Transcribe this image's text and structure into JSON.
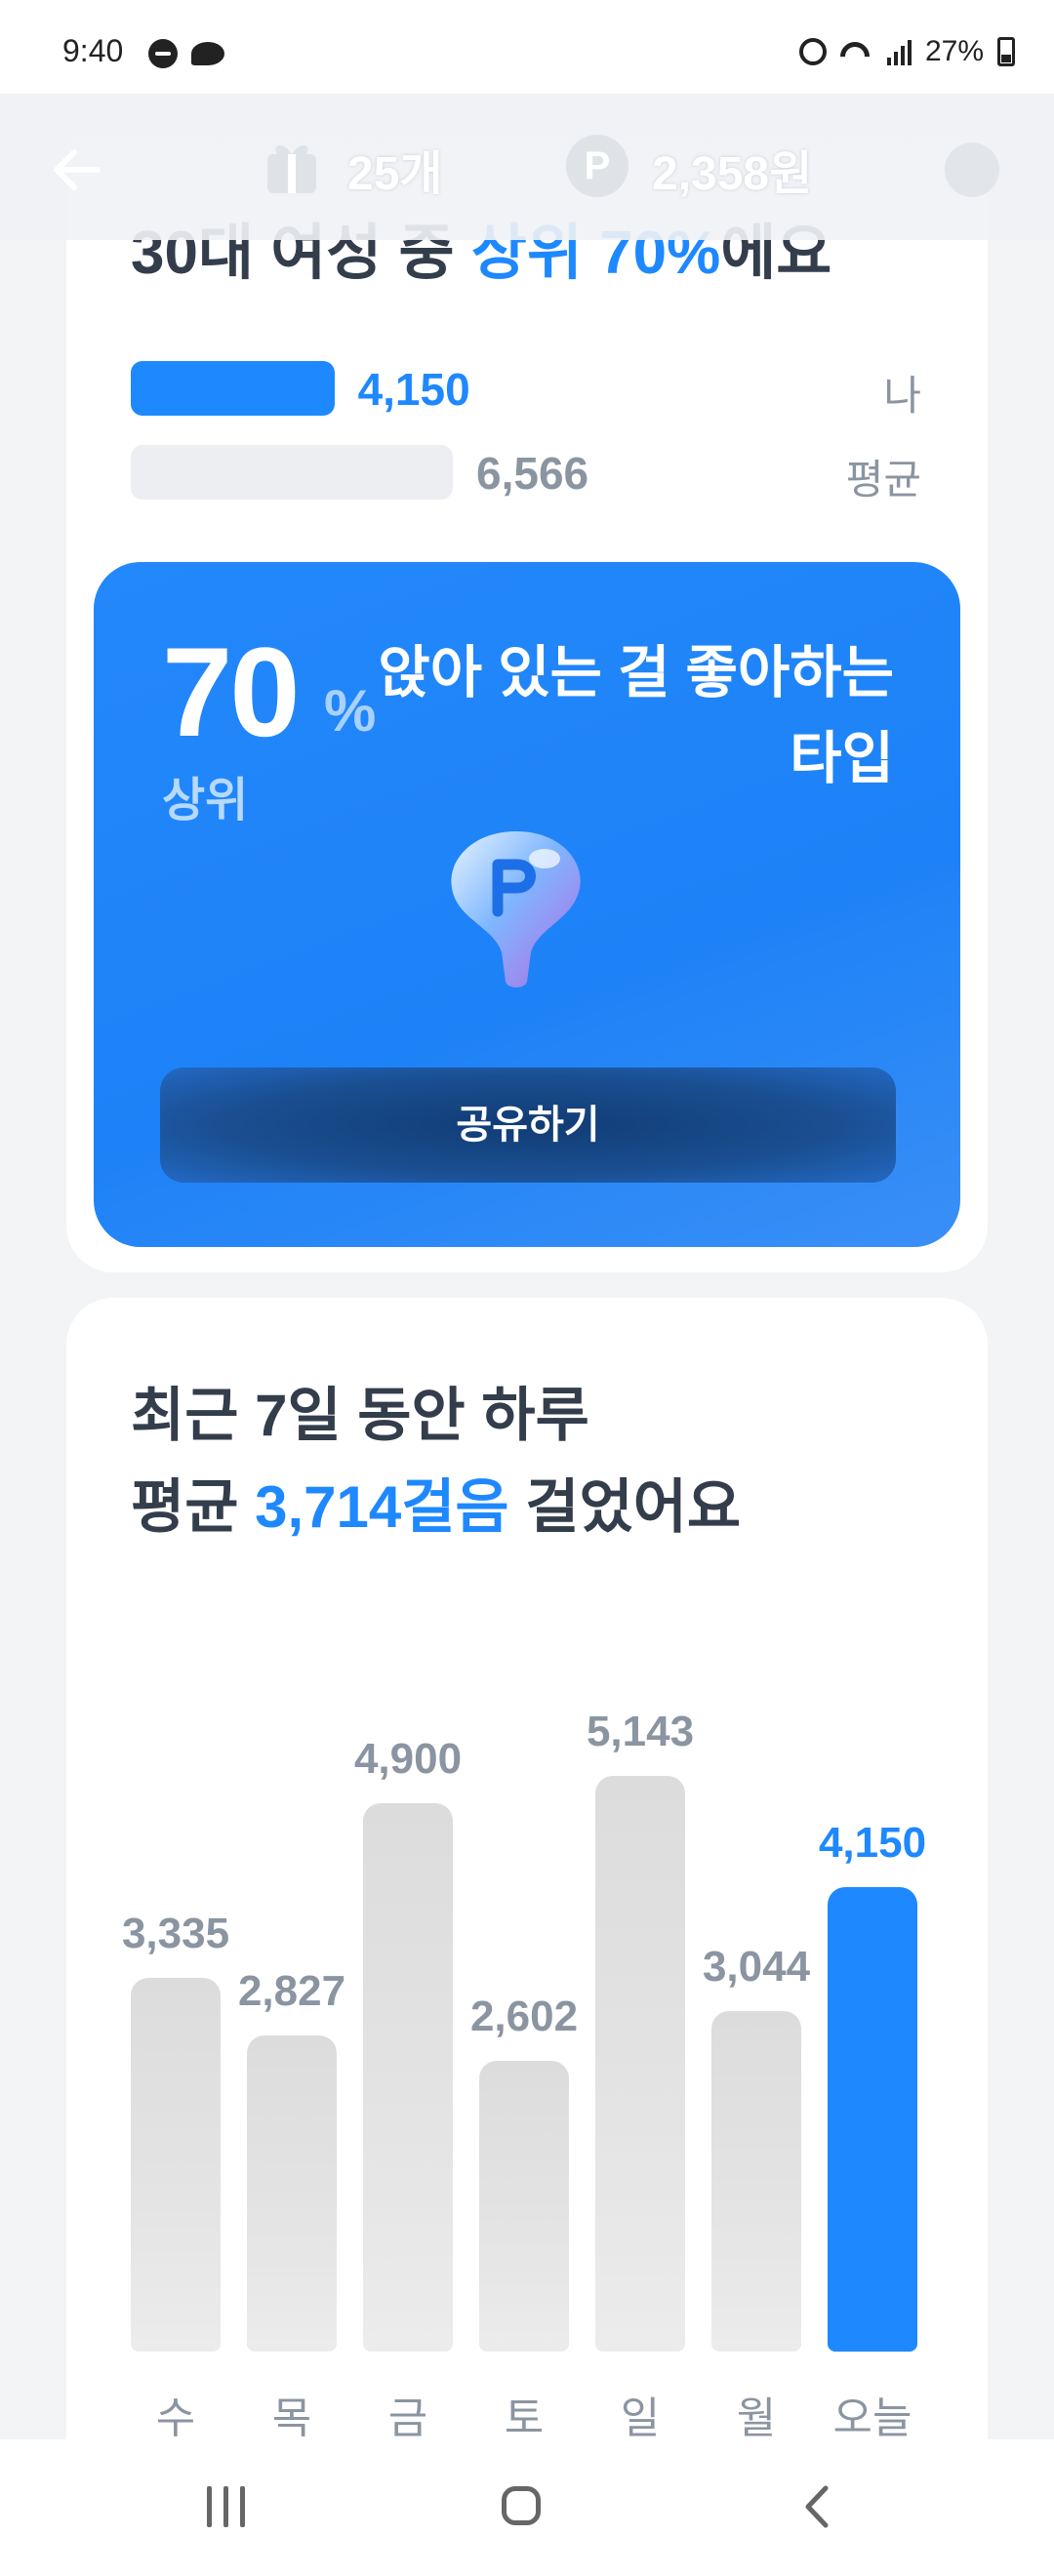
{
  "status_bar": {
    "time": "9:40",
    "battery": "27%",
    "icons": [
      "do-not-disturb-icon",
      "messenger-icon",
      "alarm-icon",
      "wifi-icon",
      "signal-icon",
      "battery-icon"
    ]
  },
  "header": {
    "gift_count": "25개",
    "points": "2,358원",
    "point_symbol": "P",
    "icons": [
      "back-arrow-icon",
      "gift-icon",
      "point-icon",
      "settings-icon"
    ]
  },
  "ranking": {
    "title_prefix": "30대 여성 중 ",
    "title_highlight": "상위 70%",
    "title_suffix": "에요",
    "mine": {
      "value": "4,150",
      "label": "나",
      "steps": 4150
    },
    "average": {
      "value": "6,566",
      "label": "평균",
      "steps": 6566
    },
    "bar_max": 6566
  },
  "type_card": {
    "percent": "70",
    "percent_sign": "%",
    "rank_label": "상위",
    "type_text": "앉아 있는 걸 좋아하는 타입",
    "share_label": "공유하기",
    "mascot_icon": "p-balloon-mascot-icon",
    "colors": {
      "card": "#1e84f8",
      "button": "#123f7a"
    }
  },
  "weekly": {
    "line1": "최근 7일 동안 하루",
    "line2_prefix": "평균 ",
    "line2_highlight": "3,714걸음",
    "line2_suffix": " 걸었어요"
  },
  "chart_data": {
    "type": "bar",
    "categories": [
      "수",
      "목",
      "금",
      "토",
      "일",
      "월",
      "오늘"
    ],
    "values": [
      3335,
      2827,
      4900,
      2602,
      5143,
      3044,
      4150
    ],
    "value_labels": [
      "3,335",
      "2,827",
      "4,900",
      "2,602",
      "5,143",
      "3,044",
      "4,150"
    ],
    "highlight_index": 6,
    "colors": {
      "default": "#dfdfdf",
      "highlight": "#1e88ff"
    }
  },
  "nav_bar": {
    "icons": [
      "recent-apps-icon",
      "home-icon",
      "back-icon"
    ]
  }
}
